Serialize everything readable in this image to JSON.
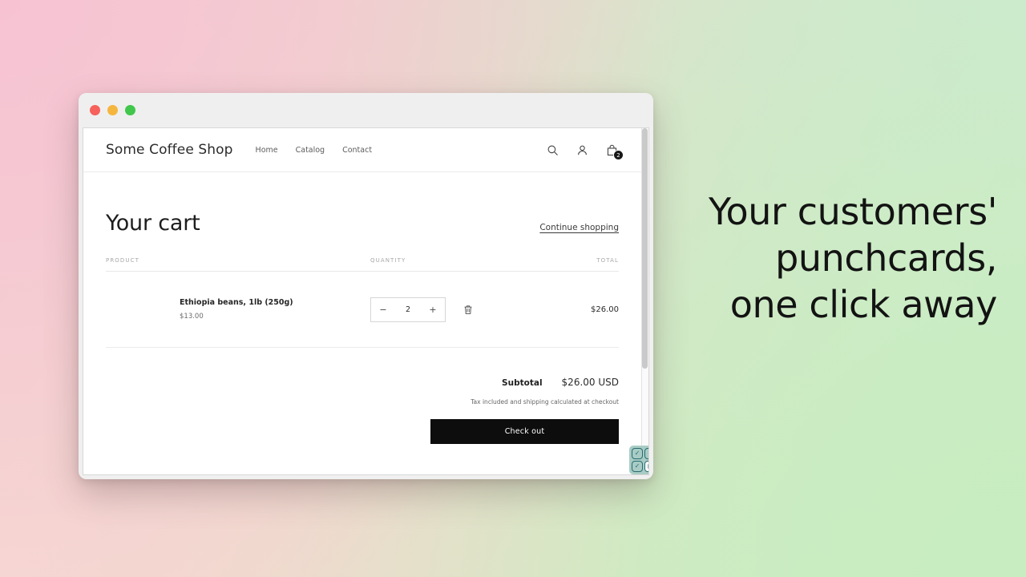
{
  "window": {
    "traffic_lights": [
      {
        "name": "close",
        "color": "#f6615b"
      },
      {
        "name": "minimize",
        "color": "#f4b63e"
      },
      {
        "name": "maximize",
        "color": "#40c74c"
      }
    ]
  },
  "site": {
    "brand": "Some Coffee Shop",
    "nav": [
      {
        "label": "Home"
      },
      {
        "label": "Catalog"
      },
      {
        "label": "Contact"
      }
    ],
    "actions": {
      "search_icon": "search-icon",
      "account_icon": "account-icon",
      "cart_icon": "cart-icon",
      "cart_count": "2"
    }
  },
  "cart": {
    "title": "Your cart",
    "continue_link": "Continue shopping",
    "columns": {
      "product": "PRODUCT",
      "quantity": "QUANTITY",
      "total": "TOTAL"
    },
    "items": [
      {
        "name": "Ethiopia beans, 1lb (250g)",
        "price": "$13.00",
        "quantity": "2",
        "decrease_label": "−",
        "increase_label": "+",
        "remove_icon": "trash-icon",
        "total": "$26.00"
      }
    ],
    "totals": {
      "subtotal_label": "Subtotal",
      "subtotal_value": "$26.00 USD",
      "tax_note": "Tax included and shipping calculated at checkout",
      "checkout_label": "Check out"
    }
  },
  "punchcard_widget": {
    "cells": [
      {
        "state": "checked",
        "glyph": "✓"
      },
      {
        "state": "checked",
        "glyph": "✓"
      },
      {
        "state": "checked",
        "glyph": "✓"
      },
      {
        "state": "filled",
        "glyph": "◼"
      }
    ],
    "accent": "#2a6b70",
    "background": "#a8ccc5"
  },
  "marketing": {
    "line1": "Your customers'",
    "line2": "punchcards,",
    "line3": "one click away"
  }
}
